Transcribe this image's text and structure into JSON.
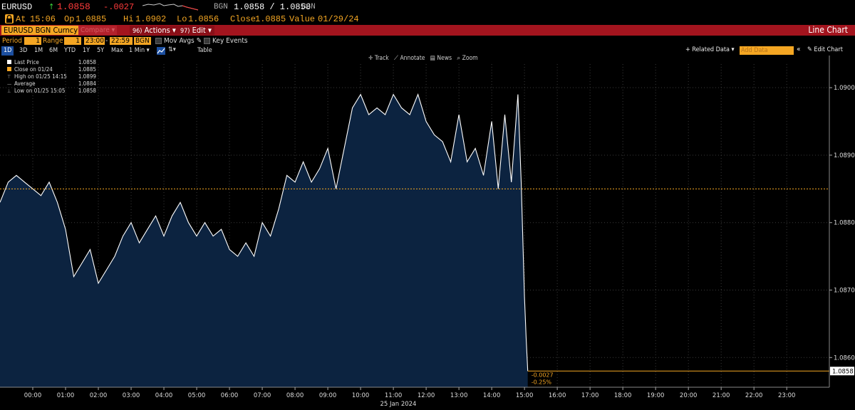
{
  "ticker": {
    "symbol": "EURUSD",
    "up_arrow": "↑",
    "last": "1.0858",
    "change": "-.0027",
    "source1": "BGN",
    "bid_ask": "1.0858 / 1.0858",
    "source2": "BGN",
    "at_label": "At",
    "at_time": "15:06",
    "open_label": "Op",
    "open": "1.0885",
    "hi_label": "Hi",
    "hi": "1.0902",
    "lo_label": "Lo",
    "lo": "1.0856",
    "close_label": "Close",
    "close": "1.0885",
    "value_label": "Value",
    "value_date": "01/29/24"
  },
  "command_bar": {
    "security": "EURUSD BGN Curncy",
    "compare_btn": "Compare",
    "actions_btn": "Actions",
    "actions_num": "96)",
    "edit_btn": "Edit",
    "edit_num": "97)",
    "title": "Line Chart"
  },
  "controls": {
    "period_label": "Period",
    "period_value": "1",
    "range_label": "Range",
    "range_value": "1",
    "range_from": "23:00",
    "range_sep": "-",
    "range_to": "22:59",
    "source": "BGN",
    "mov_avgs": "Mov Avgs",
    "key_events": "Key Events"
  },
  "tabs": {
    "t1d": "1D",
    "t3d": "3D",
    "t1m": "1M",
    "t6m": "6M",
    "tytd": "YTD",
    "t1y": "1Y",
    "t5y": "5Y",
    "tmax": "Max",
    "interval": "1 Min",
    "table": "Table",
    "related": "+ Related Data",
    "add_data_placeholder": "Add Data",
    "edit_chart": "Edit Chart"
  },
  "toolbar": {
    "track": "Track",
    "annotate": "Annotate",
    "news": "News",
    "zoom": "Zoom"
  },
  "legend": [
    {
      "label": "Last Price",
      "value": "1.0858",
      "color": "#ffffff"
    },
    {
      "label": "Close on 01/24",
      "value": "1.0885",
      "color": "#f4a623"
    },
    {
      "label": "High on 01/25 14:15",
      "value": "1.0899",
      "color": "#cccccc"
    },
    {
      "label": "Average",
      "value": "1.0884",
      "color": "#cccccc"
    },
    {
      "label": "Low on 01/25 15:05",
      "value": "1.0858",
      "color": "#cccccc"
    }
  ],
  "annotations": {
    "change": "-0.0027",
    "pct": "-0.25%",
    "last_tag": "1.0858"
  },
  "colors": {
    "accent": "#f4a623",
    "bar_red": "#a3141e",
    "area_fill": "#0c2340",
    "down": "#ff3b3b",
    "tab_active": "#1c4fa0"
  },
  "chart_data": {
    "type": "area",
    "date_label": "25 Jan 2024",
    "x_ticks": [
      "00:00",
      "01:00",
      "02:00",
      "03:00",
      "04:00",
      "05:00",
      "06:00",
      "07:00",
      "08:00",
      "09:00",
      "10:00",
      "11:00",
      "12:00",
      "13:00",
      "14:00",
      "15:00",
      "16:00",
      "17:00",
      "18:00",
      "19:00",
      "20:00",
      "21:00",
      "22:00",
      "23:00"
    ],
    "y_ticks": [
      "1.0860",
      "1.0870",
      "1.0880",
      "1.0890",
      "1.0900"
    ],
    "ylim": [
      1.08556,
      1.09035
    ],
    "xlim": [
      -1.0,
      24.3
    ],
    "reference_close": 1.0885,
    "last_value": 1.0858,
    "x": [
      -1.0,
      -0.75,
      -0.5,
      -0.25,
      0.0,
      0.25,
      0.5,
      0.75,
      1.0,
      1.25,
      1.5,
      1.75,
      2.0,
      2.25,
      2.5,
      2.75,
      3.0,
      3.25,
      3.5,
      3.75,
      4.0,
      4.25,
      4.5,
      4.75,
      5.0,
      5.25,
      5.5,
      5.75,
      6.0,
      6.25,
      6.5,
      6.75,
      7.0,
      7.25,
      7.5,
      7.75,
      8.0,
      8.25,
      8.5,
      8.75,
      9.0,
      9.25,
      9.5,
      9.75,
      10.0,
      10.25,
      10.5,
      10.75,
      11.0,
      11.25,
      11.5,
      11.75,
      12.0,
      12.25,
      12.5,
      12.75,
      13.0,
      13.25,
      13.5,
      13.75,
      14.0,
      14.2,
      14.4,
      14.6,
      14.8,
      14.9,
      15.0,
      15.05,
      15.1
    ],
    "values": [
      1.0883,
      1.0886,
      1.0887,
      1.0886,
      1.0885,
      1.0884,
      1.0886,
      1.0883,
      1.0879,
      1.0872,
      1.0874,
      1.0876,
      1.0871,
      1.0873,
      1.0875,
      1.0878,
      1.088,
      1.0877,
      1.0879,
      1.0881,
      1.0878,
      1.0881,
      1.0883,
      1.088,
      1.0878,
      1.088,
      1.0878,
      1.0879,
      1.0876,
      1.0875,
      1.0877,
      1.0875,
      1.088,
      1.0878,
      1.0882,
      1.0887,
      1.0886,
      1.0889,
      1.0886,
      1.0888,
      1.0891,
      1.0885,
      1.0891,
      1.0897,
      1.0899,
      1.0896,
      1.0897,
      1.0896,
      1.0899,
      1.0897,
      1.0896,
      1.0899,
      1.0895,
      1.0893,
      1.0892,
      1.0889,
      1.0896,
      1.0889,
      1.0891,
      1.0887,
      1.0895,
      1.0885,
      1.0896,
      1.0886,
      1.0899,
      1.0886,
      1.0869,
      1.0863,
      1.0858
    ]
  }
}
